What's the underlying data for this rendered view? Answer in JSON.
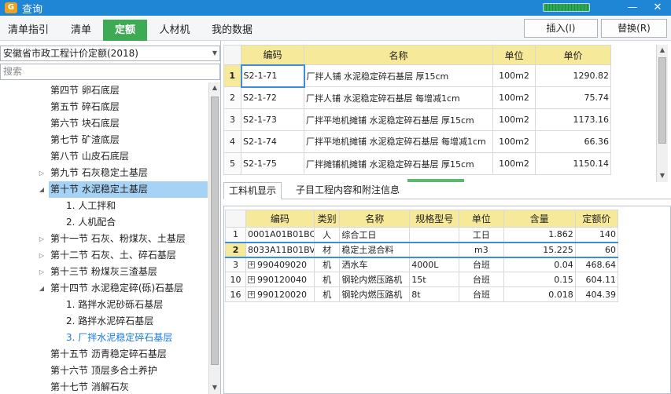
{
  "window": {
    "title": "查询",
    "progress": 1.0
  },
  "toolbar": {
    "tabs": [
      {
        "label": "清单指引"
      },
      {
        "label": "清单"
      },
      {
        "label": "定额"
      },
      {
        "label": "人材机"
      },
      {
        "label": "我的数据"
      }
    ],
    "insert_label": "插入(I)",
    "replace_label": "替换(R)"
  },
  "left": {
    "standard": "安徽省市政工程计价定额(2018)",
    "search_placeholder": "搜索",
    "tree": [
      {
        "label": "第四节 卵石底层"
      },
      {
        "label": "第五节 碎石底层"
      },
      {
        "label": "第六节 块石底层"
      },
      {
        "label": "第七节 矿渣底层"
      },
      {
        "label": "第八节 山皮石底层"
      },
      {
        "label": "第九节 石灰稳定土基层",
        "toggle": "▷"
      },
      {
        "label": "第十节 水泥稳定土基层",
        "toggle": "◢"
      },
      {
        "label": "1. 人工拌和"
      },
      {
        "label": "2. 人机配合"
      },
      {
        "label": "第十一节 石灰、粉煤灰、土基层",
        "toggle": "▷"
      },
      {
        "label": "第十二节 石灰、土、碎石基层",
        "toggle": "▷"
      },
      {
        "label": "第十三节 粉煤灰三渣基层",
        "toggle": "▷"
      },
      {
        "label": "第十四节 水泥稳定碎(砾)石基层",
        "toggle": "◢"
      },
      {
        "label": "1. 路拌水泥砂砾石基层"
      },
      {
        "label": "2. 路拌水泥碎石基层"
      },
      {
        "label": "3. 厂拌水泥稳定碎石基层"
      },
      {
        "label": "第十五节 沥青稳定碎石基层"
      },
      {
        "label": "第十六节 顶层多合土养护"
      },
      {
        "label": "第十七节 消解石灰"
      }
    ]
  },
  "quota": {
    "headers": [
      "编码",
      "名称",
      "单位",
      "单价"
    ],
    "rows": [
      {
        "no": "1",
        "code": "S2-1-71",
        "name": "厂拌人铺 水泥稳定碎石基层 厚15cm",
        "unit": "100m2",
        "price": "1290.82"
      },
      {
        "no": "2",
        "code": "S2-1-72",
        "name": "厂拌人铺 水泥稳定碎石基层 每增减1cm",
        "unit": "100m2",
        "price": "75.74"
      },
      {
        "no": "3",
        "code": "S2-1-73",
        "name": "厂拌平地机摊铺 水泥稳定碎石基层 厚15cm",
        "unit": "100m2",
        "price": "1173.16"
      },
      {
        "no": "4",
        "code": "S2-1-74",
        "name": "厂拌平地机摊铺 水泥稳定碎石基层 每增减1cm",
        "unit": "100m2",
        "price": "66.36"
      },
      {
        "no": "5",
        "code": "S2-1-75",
        "name": "厂拌摊铺机摊铺 水泥稳定碎石基层 厚15cm",
        "unit": "100m2",
        "price": "1150.14"
      }
    ]
  },
  "detail": {
    "tabs": [
      {
        "label": "工料机显示"
      },
      {
        "label": "子目工程内容和附注信息"
      }
    ],
    "headers": [
      "编码",
      "类别",
      "名称",
      "规格型号",
      "单位",
      "含量",
      "定额价"
    ],
    "rows": [
      {
        "no": "1",
        "code": "0001A01B01BC",
        "cat": "人",
        "name": "综合工日",
        "spec": "",
        "unit": "工日",
        "qty": "1.862",
        "price": "140",
        "expand": false
      },
      {
        "no": "2",
        "code": "8033A11B01BV",
        "cat": "材",
        "name": "稳定土混合料",
        "spec": "",
        "unit": "m3",
        "qty": "15.225",
        "price": "60",
        "expand": false
      },
      {
        "no": "3",
        "code": "990409020",
        "cat": "机",
        "name": "洒水车",
        "spec": "4000L",
        "unit": "台班",
        "qty": "0.04",
        "price": "468.64",
        "expand": true
      },
      {
        "no": "10",
        "code": "990120040",
        "cat": "机",
        "name": "钢轮内燃压路机",
        "spec": "15t",
        "unit": "台班",
        "qty": "0.15",
        "price": "604.11",
        "expand": true
      },
      {
        "no": "16",
        "code": "990120020",
        "cat": "机",
        "name": "钢轮内燃压路机",
        "spec": "8t",
        "unit": "台班",
        "qty": "0.018",
        "price": "404.39",
        "expand": true
      }
    ]
  }
}
